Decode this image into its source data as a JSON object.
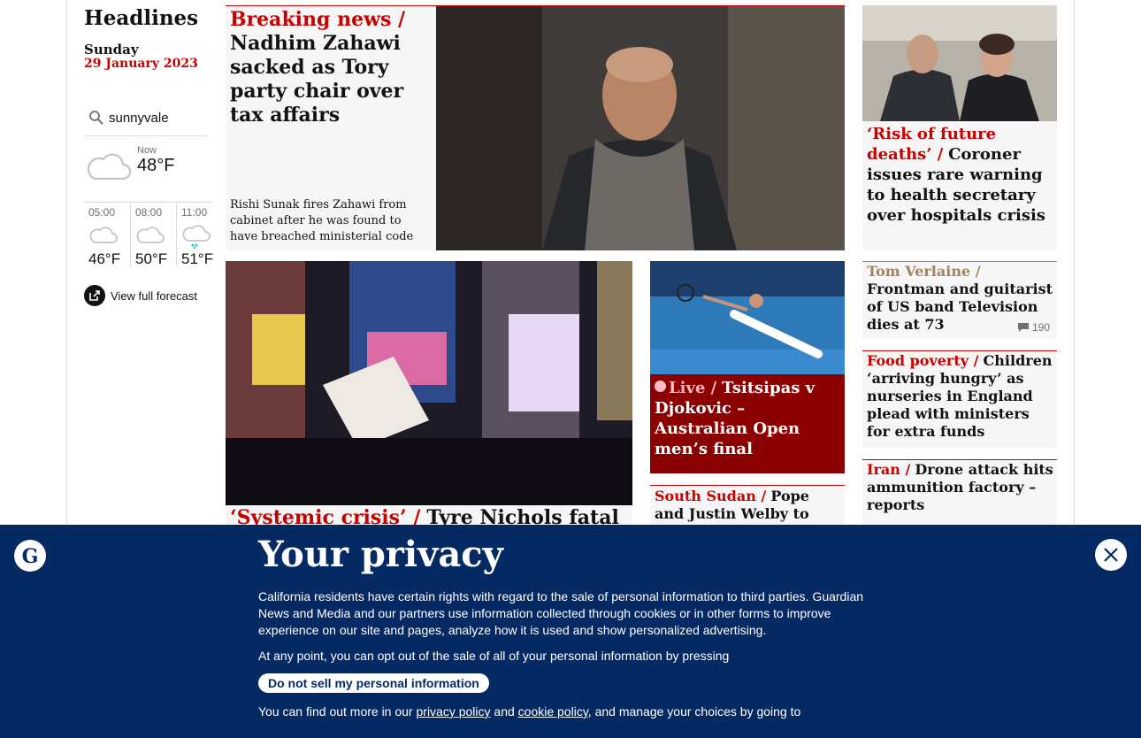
{
  "sidebar": {
    "section_title": "Headlines",
    "day": "Sunday",
    "date": "29 January 2023",
    "search_value": "sunnyvale",
    "now_label": "Now",
    "now_temp": "48°F",
    "forecast": [
      {
        "time": "05:00",
        "temp": "46°F",
        "icon": "cloud-icon"
      },
      {
        "time": "08:00",
        "temp": "50°F",
        "icon": "cloud-icon"
      },
      {
        "time": "11:00",
        "temp": "51°F",
        "icon": "cloud-rain-icon"
      }
    ],
    "full_forecast_label": "View full forecast"
  },
  "hero": {
    "kicker": "Breaking news /",
    "headline": "Nadhim Zahawi sacked as Tory party chair over tax affairs",
    "standfirst": "Rishi Sunak fires Zahawi from cabinet after he was found to have breached ministerial code"
  },
  "coroner": {
    "kicker": "‘Risk of future deaths’ /",
    "headline": "Coroner issues rare warning to health secretary over hospitals crisis"
  },
  "tyre": {
    "kicker": "‘Systemic crisis’ /",
    "headline": "Tyre Nichols fatal"
  },
  "live": {
    "kicker": "Live /",
    "headline": "Tsitsipas v Djokovic – Australian Open men’s final"
  },
  "sudan": {
    "kicker": "South Sudan /",
    "headline": "Pope and Justin Welby to visit"
  },
  "tom": {
    "kicker": "Tom Verlaine /",
    "headline": "Frontman and guitarist of US band Television dies at 73",
    "comments": "190"
  },
  "food": {
    "kicker": "Food poverty /",
    "headline": "Children ‘arriving hungry’ as nurseries in England plead with ministers for extra funds"
  },
  "iran": {
    "kicker": "Iran /",
    "headline": "Drone attack hits ammunition factory – reports"
  },
  "privacy": {
    "title": "Your privacy",
    "para1": "California residents have certain rights with regard to the sale of personal information to third parties. Guardian News and Media and our partners use information collected through cookies or in other forms to improve experience on our site and pages, analyze how it is used and show personalized advertising.",
    "para2": "At any point, you can opt out of the sale of all of your personal information by pressing",
    "button": "Do not sell my personal information",
    "para3_start": "You can find out more in our",
    "privacy_link": "privacy policy",
    "and": "and",
    "cookie_link": "cookie policy",
    "para3_end": ", and manage your choices by going to"
  },
  "colors": {
    "news_red": "#c70000",
    "culture_tan": "#a1845c",
    "live_bg": "#8b0000",
    "banner_bg": "#052962"
  }
}
